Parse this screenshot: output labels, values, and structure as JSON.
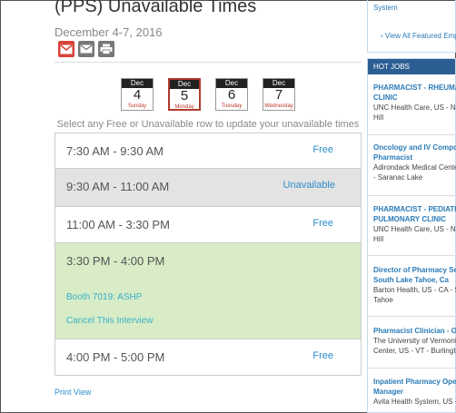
{
  "page": {
    "title": "(PPS) Unavailable Times",
    "date_range": "December 4-7, 2016",
    "instruction": "Select any Free or Unavailable row to update your unavailable times",
    "print_view": "Print View"
  },
  "share_icons": [
    "gmail-icon",
    "mail-icon",
    "print-icon"
  ],
  "days": [
    {
      "month": "Dec",
      "num": "4",
      "weekday": "Sunday",
      "active": false
    },
    {
      "month": "Dec",
      "num": "5",
      "weekday": "Monday",
      "active": true
    },
    {
      "month": "Dec",
      "num": "6",
      "weekday": "Tuesday",
      "active": false
    },
    {
      "month": "Dec",
      "num": "7",
      "weekday": "Wednesday",
      "active": false
    }
  ],
  "slots": [
    {
      "time": "7:30 AM - 9:30 AM",
      "status": "Free"
    },
    {
      "time": "9:30 AM - 11:00 AM",
      "status": "Unavailable"
    },
    {
      "time": "11:00 AM - 3:30 PM",
      "status": "Free"
    },
    {
      "time": "3:30 PM - 4:00 PM",
      "status": "",
      "booth": "Booth 7019: ASHP",
      "cancel": "Cancel This Interview"
    },
    {
      "time": "4:00 PM - 5:00 PM",
      "status": "Free"
    }
  ],
  "sidebar": {
    "system": "System",
    "view_all": "View All Featured Emp",
    "hot_jobs_title": "HOT JOBS",
    "jobs": [
      {
        "title1": "PHARMACIST - RHEUMAT",
        "title2": "CLINIC",
        "company1": "UNC Health Care, US - NC",
        "company2": "Hill"
      },
      {
        "title1": "Oncology and IV Compou",
        "title2": "Pharmacist",
        "company1": "Adirondack Medical Cente",
        "company2": "- Saranac Lake"
      },
      {
        "title1": "PHARMACIST - PEDIATRIC",
        "title2": "PULMONARY CLINIC",
        "company1": "UNC Health Care, US - NC",
        "company2": "Hill"
      },
      {
        "title1": "Director of Pharmacy Ser",
        "title2": "South Lake Tahoe, Ca",
        "company1": "Barton Health, US - CA - Se",
        "company2": "Tahoe"
      },
      {
        "title1": "Pharmacist Clinician - On",
        "title2": "",
        "company1": "The University of Vermont",
        "company2": "Center, US - VT - Burlingto"
      },
      {
        "title1": "Inpatient Pharmacy Oper",
        "title2": "Manager",
        "company1": "Avita Health System, US -",
        "company2": ""
      }
    ]
  },
  "colors": {
    "link": "#2a8dc9",
    "green_row": "#d7ecc7",
    "gray_row": "#e3e3e3",
    "hot_jobs_header": "#2d5e93",
    "gmail": "#d9433a"
  }
}
